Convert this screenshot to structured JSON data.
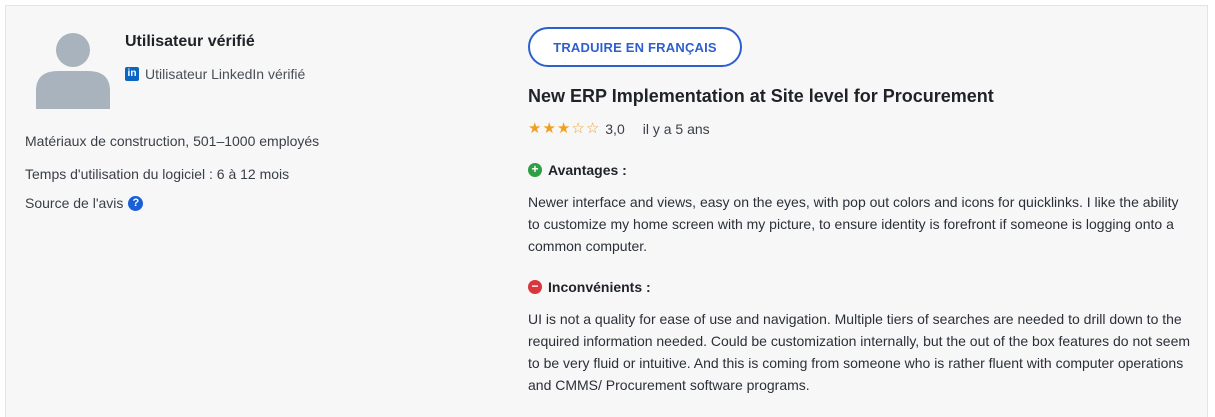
{
  "colors": {
    "accent": "#2d5fce",
    "linkedin": "#0a66c2",
    "star": "#f0a021",
    "pros": "#2f9e44",
    "cons": "#d9363e",
    "help": "#1a5fd6"
  },
  "reviewer": {
    "avatar_icon": "user-avatar-icon",
    "name": "Utilisateur vérifié",
    "linkedin_icon": "linkedin-icon",
    "linkedin_label": "Utilisateur LinkedIn vérifié",
    "company": "Matériaux de construction, 501–1000 employés",
    "usage": "Temps d'utilisation du logiciel : 6 à 12 mois",
    "source_label": "Source de l'avis",
    "source_icon": "help-icon"
  },
  "review": {
    "translate_label": "TRADUIRE EN FRANÇAIS",
    "title": "New ERP Implementation at Site level for Procurement",
    "rating": 3.0,
    "rating_max": 5,
    "rating_text": "3,0",
    "date": "il y a 5 ans",
    "pros_icon": "plus-circle-icon",
    "pros_label": "Avantages :",
    "pros_text": "Newer interface and views, easy on the eyes, with pop out colors and icons for quicklinks. I like the ability to customize my home screen with my picture, to ensure identity is forefront if someone is logging onto a common computer.",
    "cons_icon": "minus-circle-icon",
    "cons_label": "Inconvénients :",
    "cons_text": "UI is not a quality for ease of use and navigation. Multiple tiers of searches are needed to drill down to the required information needed. Could be customization internally, but the out of the box features do not seem to be very fluid or intuitive. And this is coming from someone who is rather fluent with computer operations and CMMS/ Procurement software programs."
  }
}
